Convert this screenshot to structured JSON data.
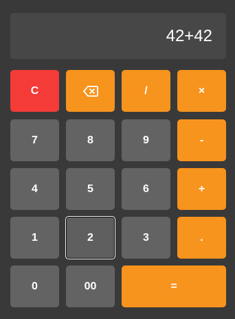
{
  "display": {
    "value": "42+42"
  },
  "keys": {
    "clear": "C",
    "backspace_icon": "backspace-icon",
    "divide": "/",
    "multiply": "×",
    "seven": "7",
    "eight": "8",
    "nine": "9",
    "minus": "-",
    "four": "4",
    "five": "5",
    "six": "6",
    "plus": "+",
    "one": "1",
    "two": "2",
    "three": "3",
    "decimal": ".",
    "zero": "0",
    "double_zero": "00",
    "equals": "="
  },
  "colors": {
    "background": "#393939",
    "display": "#474747",
    "number_key": "#636363",
    "operator_key": "#f7941d",
    "clear_key": "#f43b38",
    "text": "#ffffff"
  },
  "focused_key": "2"
}
